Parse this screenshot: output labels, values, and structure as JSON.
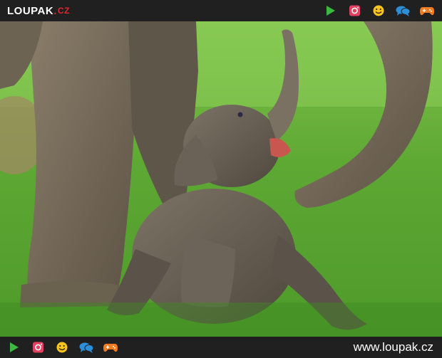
{
  "header": {
    "logo_text": "LOUPAK",
    "logo_dot": ".",
    "logo_tld": "CZ"
  },
  "icons": [
    {
      "name": "play-icon",
      "color": "#3db843"
    },
    {
      "name": "instagram-icon",
      "color": "#e4405f"
    },
    {
      "name": "smiley-icon",
      "color": "#f7c51e"
    },
    {
      "name": "chat-icon",
      "color": "#2d8fd8"
    },
    {
      "name": "gamepad-icon",
      "color": "#f07c1f"
    }
  ],
  "photo": {
    "subject": "baby-elephant-photo"
  },
  "footer": {
    "site_url": "www.loupak.cz"
  },
  "colors": {
    "bar_background": "#202020",
    "accent_red": "#e3262d",
    "grass_green": "#5fae2e"
  }
}
